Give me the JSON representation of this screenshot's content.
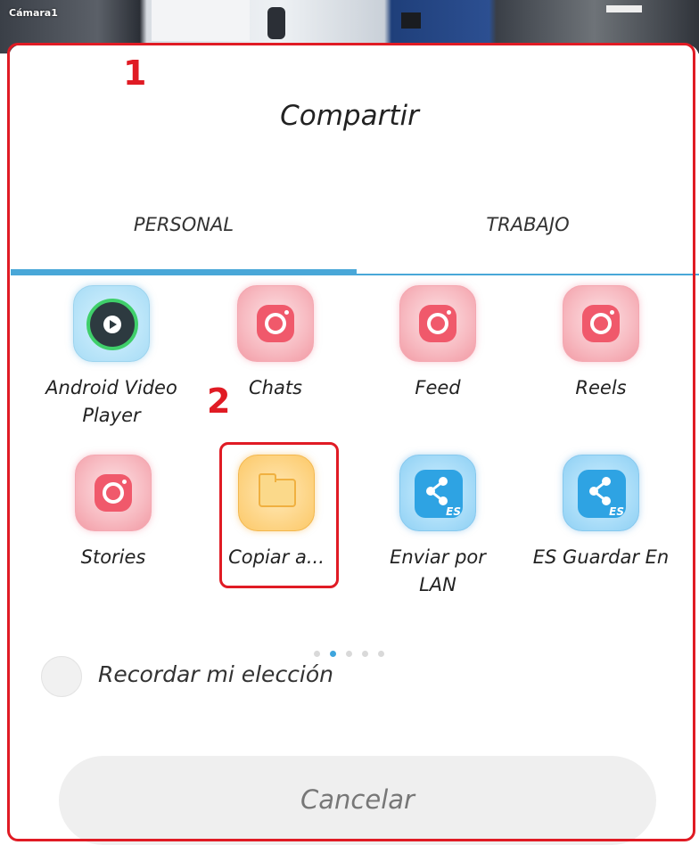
{
  "camera": {
    "label": "Cámara1"
  },
  "annotations": {
    "one": "1",
    "two": "2"
  },
  "dialog": {
    "title": "Compartir",
    "tabs": [
      {
        "label": "PERSONAL",
        "active": true
      },
      {
        "label": "TRABAJO",
        "active": false
      }
    ],
    "apps": [
      {
        "label_line1": "Android Video",
        "label_line2": "Player",
        "icon": "video-player-icon"
      },
      {
        "label_line1": "Chats",
        "label_line2": "",
        "icon": "instagram-icon"
      },
      {
        "label_line1": "Feed",
        "label_line2": "",
        "icon": "instagram-icon"
      },
      {
        "label_line1": "Reels",
        "label_line2": "",
        "icon": "instagram-icon"
      },
      {
        "label_line1": "Stories",
        "label_line2": "",
        "icon": "instagram-icon"
      },
      {
        "label_line1": "Copiar a...",
        "label_line2": "",
        "icon": "folder-icon"
      },
      {
        "label_line1": "Enviar por",
        "label_line2": "LAN",
        "icon": "es-share-icon"
      },
      {
        "label_line1": "ES Guardar En",
        "label_line2": "",
        "icon": "es-share-icon"
      }
    ],
    "page_indicator": {
      "pages": 5,
      "current": 2
    },
    "remember": {
      "label": "Recordar mi elección",
      "checked": false
    },
    "cancel_label": "Cancelar"
  },
  "colors": {
    "accent": "#49a7d8",
    "annotation": "#e01b24"
  }
}
